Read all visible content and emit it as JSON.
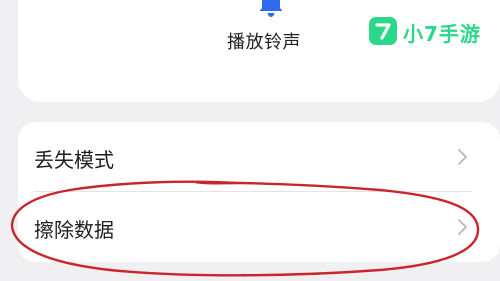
{
  "top_card": {
    "bell_icon": "bell-icon",
    "play_sound_label": "播放铃声"
  },
  "list": {
    "items": [
      {
        "label": "丢失模式",
        "icon": "chevron-right-icon"
      },
      {
        "label": "擦除数据",
        "icon": "chevron-right-icon"
      }
    ]
  },
  "watermark": {
    "text": "小7手游",
    "badge_glyph": "7"
  },
  "colors": {
    "accent_blue": "#2f6bf0",
    "watermark_green": "#2bd88a",
    "annotation_red": "#c9252c"
  }
}
